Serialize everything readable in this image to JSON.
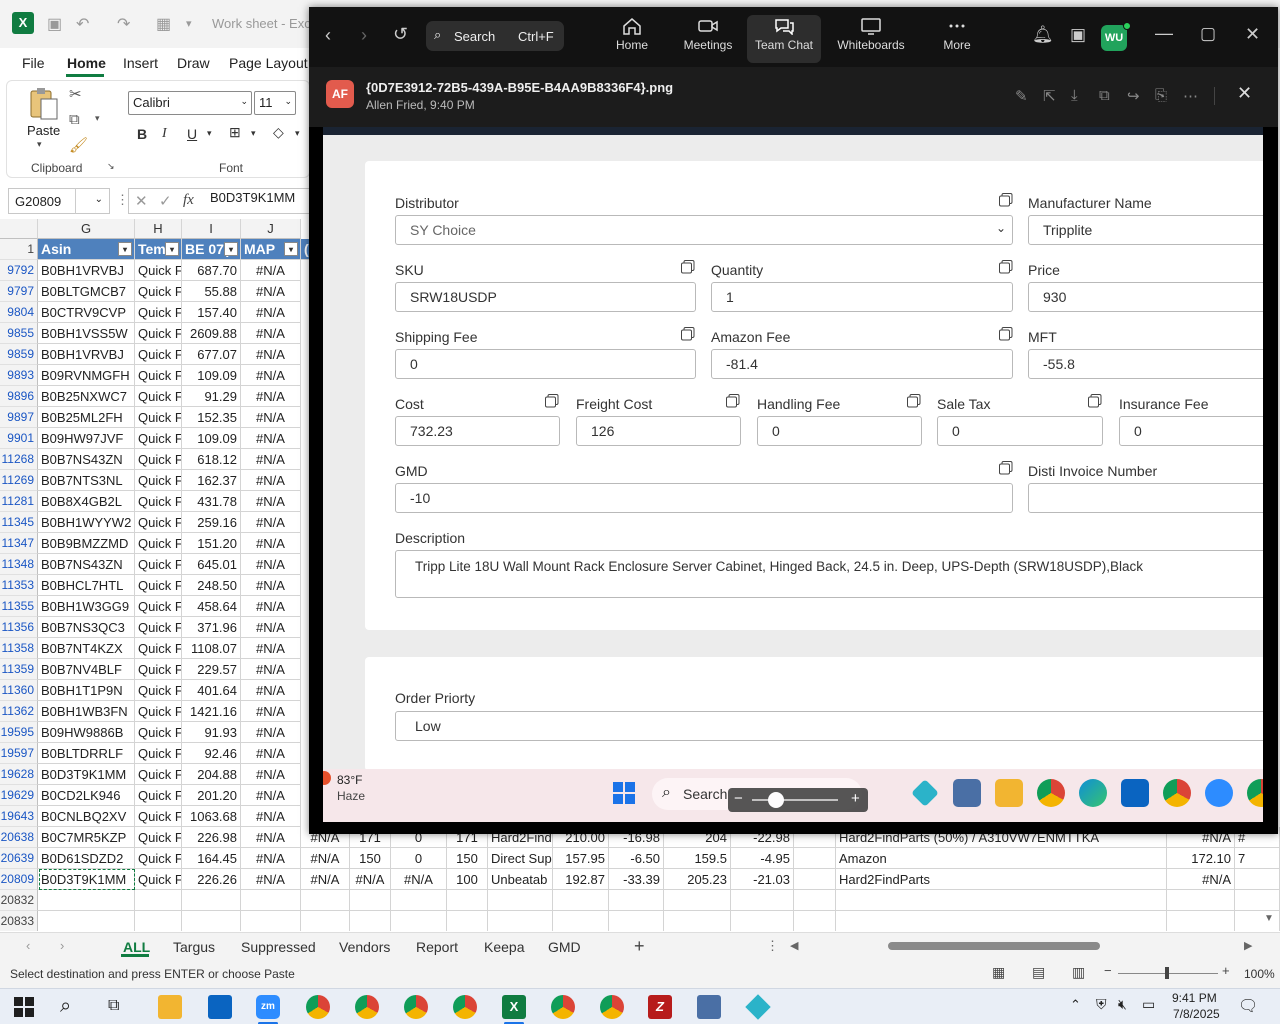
{
  "excel": {
    "doc_title": "Work sheet - Exc",
    "tabs": [
      "File",
      "Home",
      "Insert",
      "Draw",
      "Page Layout"
    ],
    "active_tab": "Home",
    "font_name": "Calibri",
    "font_size": "11",
    "paste_label": "Paste",
    "clipboard_label": "Clipboard",
    "font_group_label": "Font",
    "name_box": "G20809",
    "fx_symbol": "fx",
    "formula": "B0D3T9K1MM",
    "columns": [
      "G",
      "H",
      "I",
      "J"
    ],
    "header_row": {
      "num": "1",
      "asin": "Asin",
      "tem": "Tem",
      "be": "BE 07(",
      "map": "MAP",
      "next": "("
    },
    "rows": [
      {
        "n": "9792",
        "asin": "B0BH1VRVBJ",
        "tem": "Quick F",
        "be": "687.70",
        "map": "#N/A"
      },
      {
        "n": "9797",
        "asin": "B0BLTGMCB7",
        "tem": "Quick F",
        "be": "55.88",
        "map": "#N/A"
      },
      {
        "n": "9804",
        "asin": "B0CTRV9CVP",
        "tem": "Quick F",
        "be": "157.40",
        "map": "#N/A"
      },
      {
        "n": "9855",
        "asin": "B0BH1VSS5W",
        "tem": "Quick F",
        "be": "2609.88",
        "map": "#N/A"
      },
      {
        "n": "9859",
        "asin": "B0BH1VRVBJ",
        "tem": "Quick F",
        "be": "677.07",
        "map": "#N/A"
      },
      {
        "n": "9893",
        "asin": "B09RVNMGFH",
        "tem": "Quick F",
        "be": "109.09",
        "map": "#N/A"
      },
      {
        "n": "9896",
        "asin": "B0B25NXWC7",
        "tem": "Quick F",
        "be": "91.29",
        "map": "#N/A"
      },
      {
        "n": "9897",
        "asin": "B0B25ML2FH",
        "tem": "Quick F",
        "be": "152.35",
        "map": "#N/A"
      },
      {
        "n": "9901",
        "asin": "B09HW97JVF",
        "tem": "Quick F",
        "be": "109.09",
        "map": "#N/A"
      },
      {
        "n": "11268",
        "asin": "B0B7NS43ZN",
        "tem": "Quick F",
        "be": "618.12",
        "map": "#N/A"
      },
      {
        "n": "11269",
        "asin": "B0B7NTS3NL",
        "tem": "Quick F",
        "be": "162.37",
        "map": "#N/A"
      },
      {
        "n": "11281",
        "asin": "B0B8X4GB2L",
        "tem": "Quick F",
        "be": "431.78",
        "map": "#N/A"
      },
      {
        "n": "11345",
        "asin": "B0BH1WYYW2",
        "tem": "Quick F",
        "be": "259.16",
        "map": "#N/A"
      },
      {
        "n": "11347",
        "asin": "B0B9BMZZMD",
        "tem": "Quick F",
        "be": "151.20",
        "map": "#N/A"
      },
      {
        "n": "11348",
        "asin": "B0B7NS43ZN",
        "tem": "Quick F",
        "be": "645.01",
        "map": "#N/A"
      },
      {
        "n": "11353",
        "asin": "B0BHCL7HTL",
        "tem": "Quick F",
        "be": "248.50",
        "map": "#N/A"
      },
      {
        "n": "11355",
        "asin": "B0BH1W3GG9",
        "tem": "Quick F",
        "be": "458.64",
        "map": "#N/A"
      },
      {
        "n": "11356",
        "asin": "B0B7NS3QC3",
        "tem": "Quick F",
        "be": "371.96",
        "map": "#N/A"
      },
      {
        "n": "11358",
        "asin": "B0B7NT4KZX",
        "tem": "Quick F",
        "be": "1108.07",
        "map": "#N/A"
      },
      {
        "n": "11359",
        "asin": "B0B7NV4BLF",
        "tem": "Quick F",
        "be": "229.57",
        "map": "#N/A"
      },
      {
        "n": "11360",
        "asin": "B0BH1T1P9N",
        "tem": "Quick F",
        "be": "401.64",
        "map": "#N/A"
      },
      {
        "n": "11362",
        "asin": "B0BH1WB3FN",
        "tem": "Quick F",
        "be": "1421.16",
        "map": "#N/A"
      },
      {
        "n": "19595",
        "asin": "B09HW9886B",
        "tem": "Quick F",
        "be": "91.93",
        "map": "#N/A"
      },
      {
        "n": "19597",
        "asin": "B0BLTDRRLF",
        "tem": "Quick F",
        "be": "92.46",
        "map": "#N/A"
      },
      {
        "n": "19628",
        "asin": "B0D3T9K1MM",
        "tem": "Quick F",
        "be": "204.88",
        "map": "#N/A"
      },
      {
        "n": "19629",
        "asin": "B0CD2LK946",
        "tem": "Quick F",
        "be": "201.20",
        "map": "#N/A"
      },
      {
        "n": "19643",
        "asin": "B0CNLBQ2XV",
        "tem": "Quick F",
        "be": "1063.68",
        "map": "#N/A"
      }
    ],
    "wide_rows": [
      {
        "n": "20638",
        "asin": "B0C7MR5KZP",
        "tem": "Quick F",
        "be": "226.98",
        "map": "#N/A",
        "k": "#N/A",
        "l": "171",
        "m": "0",
        "n2": "171",
        "o": "Hard2Find",
        "p": "210.00",
        "q": "-16.98",
        "r": "204",
        "s": "-22.98",
        "u": "Hard2FindParts (50%) / A310VW7ENMTTKA",
        "v": "#N/A",
        "w": "#"
      },
      {
        "n": "20639",
        "asin": "B0D61SDZD2",
        "tem": "Quick F",
        "be": "164.45",
        "map": "#N/A",
        "k": "#N/A",
        "l": "150",
        "m": "0",
        "n2": "150",
        "o": "Direct Sup",
        "p": "157.95",
        "q": "-6.50",
        "r": "159.5",
        "s": "-4.95",
        "u": "Amazon",
        "v": "172.10",
        "w": "7"
      },
      {
        "n": "20809",
        "asin": "B0D3T9K1MM",
        "tem": "Quick F",
        "be": "226.26",
        "map": "#N/A",
        "k": "#N/A",
        "l": "#N/A",
        "m": "#N/A",
        "n2": "100",
        "o": "Unbeatab",
        "p": "192.87",
        "q": "-33.39",
        "r": "205.23",
        "s": "-21.03",
        "u": "Hard2FindParts",
        "v": "#N/A",
        "w": ""
      }
    ],
    "empty_rows": [
      "20832",
      "20833"
    ],
    "sheet_tabs": [
      "ALL",
      "Targus",
      "Suppressed",
      "Vendors",
      "Report",
      "Keepa",
      "GMD"
    ],
    "active_sheet": "ALL",
    "status_message": "Select destination and press ENTER or choose Paste",
    "zoom_level": "100%"
  },
  "zoom_app": {
    "search_label": "Search",
    "search_shortcut": "Ctrl+F",
    "nav_tabs": [
      "Home",
      "Meetings",
      "Team Chat",
      "Whiteboards",
      "More"
    ],
    "active_tab": "Team Chat",
    "avatar_initials": "WU",
    "sender_initials": "AF",
    "image_name": "{0D7E3912-72B5-439A-B95E-B4AA9B8336F4}.png",
    "image_meta": "Allen Fried, 9:40 PM",
    "form": {
      "distributor_label": "Distributor",
      "distributor_value": "SY Choice",
      "manufacturer_label": "Manufacturer Name",
      "manufacturer_value": "Tripplite",
      "sku_label": "SKU",
      "sku_value": "SRW18USDP",
      "quantity_label": "Quantity",
      "quantity_value": "1",
      "price_label": "Price",
      "price_value": "930",
      "shipping_label": "Shipping Fee",
      "shipping_value": "0",
      "amazon_fee_label": "Amazon Fee",
      "amazon_fee_value": "-81.4",
      "mft_label": "MFT",
      "mft_value": "-55.8",
      "cost_label": "Cost",
      "cost_value": "732.23",
      "freight_label": "Freight Cost",
      "freight_value": "126",
      "handling_label": "Handling Fee",
      "handling_value": "0",
      "sale_tax_label": "Sale Tax",
      "sale_tax_value": "0",
      "insurance_label": "Insurance Fee",
      "insurance_value": "0",
      "gmd_label": "GMD",
      "gmd_value": "-10",
      "disti_invoice_label": "Disti Invoice Number",
      "disti_invoice_value": "",
      "description_label": "Description",
      "description_value": "Tripp Lite 18U Wall Mount Rack Enclosure Server Cabinet, Hinged Back, 24.5 in. Deep, UPS-Depth (SRW18USDP),Black",
      "order_priority_label": "Order Priorty",
      "order_priority_value": "Low"
    },
    "inner_taskbar": {
      "temperature": "83°F",
      "condition": "Haze",
      "search": "Search"
    }
  },
  "taskbar": {
    "time": "9:41 PM",
    "date": "7/8/2025"
  }
}
